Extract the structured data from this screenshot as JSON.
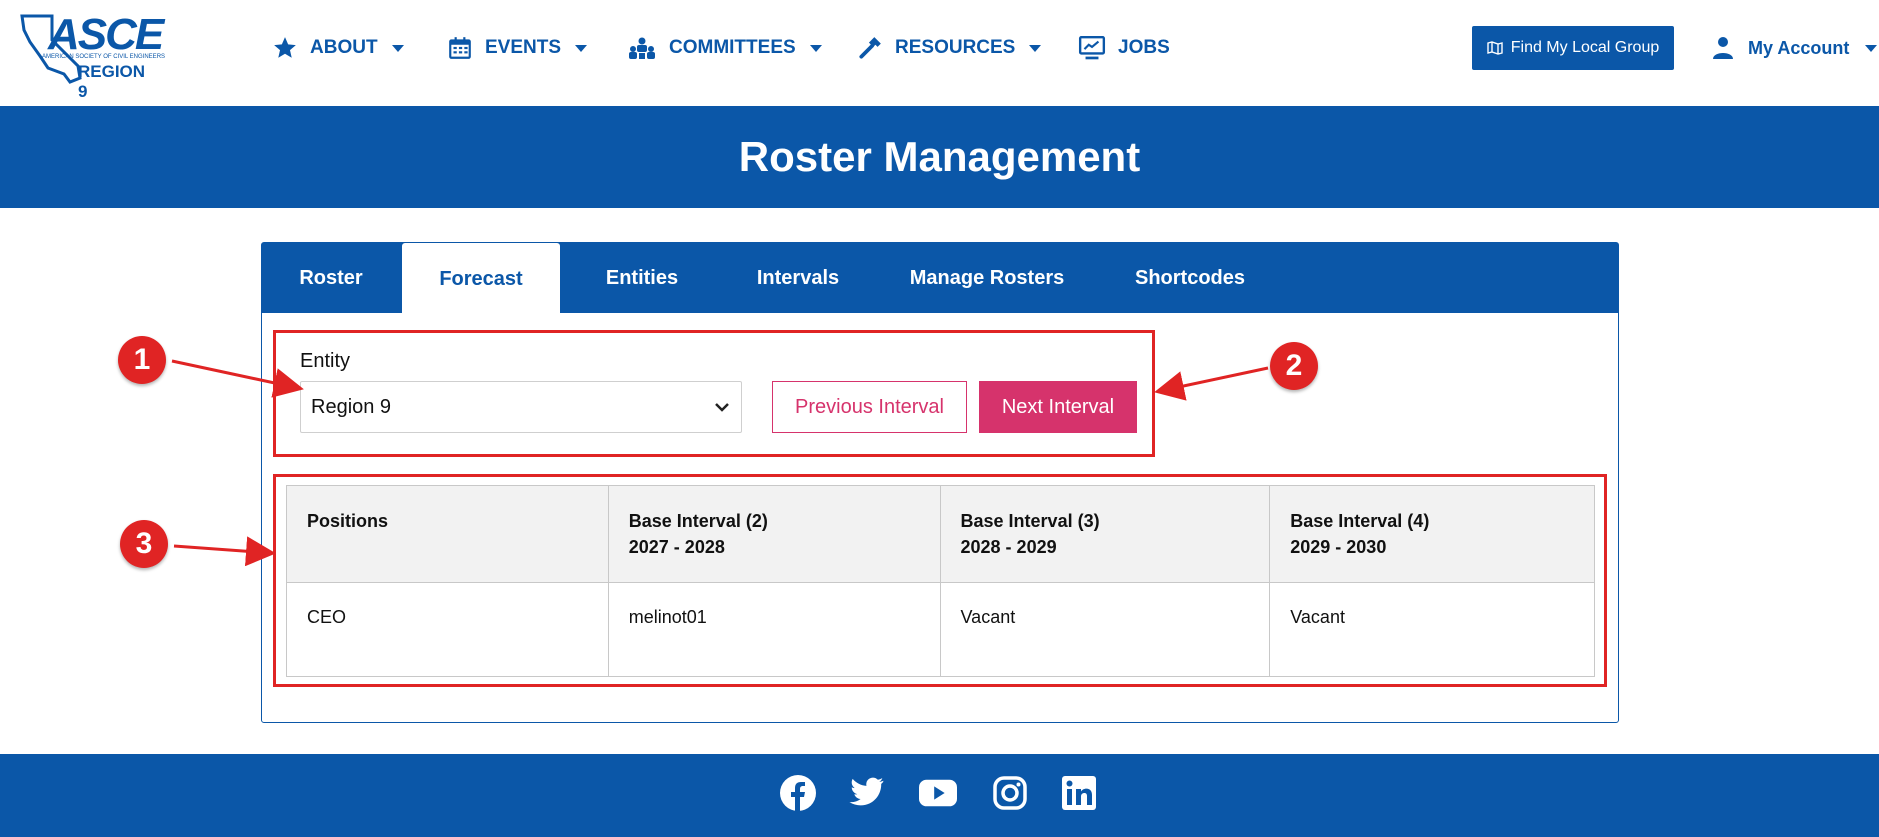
{
  "logo": {
    "name": "ASCE",
    "tagline": "AMERICAN SOCIETY OF CIVIL ENGINEERS",
    "region": "REGION 9"
  },
  "nav": {
    "items": [
      {
        "label": "ABOUT",
        "icon": "star-icon",
        "has_dropdown": true
      },
      {
        "label": "EVENTS",
        "icon": "calendar-icon",
        "has_dropdown": true
      },
      {
        "label": "COMMITTEES",
        "icon": "group-icon",
        "has_dropdown": true
      },
      {
        "label": "RESOURCES",
        "icon": "hammer-icon",
        "has_dropdown": true
      },
      {
        "label": "JOBS",
        "icon": "monitor-chart-icon",
        "has_dropdown": false
      }
    ],
    "find_group_label": "Find My Local Group",
    "account_label": "My Account"
  },
  "banner": {
    "title": "Roster Management"
  },
  "tabs": [
    {
      "label": "Roster",
      "active": false
    },
    {
      "label": "Forecast",
      "active": true
    },
    {
      "label": "Entities",
      "active": false
    },
    {
      "label": "Intervals",
      "active": false
    },
    {
      "label": "Manage Rosters",
      "active": false
    },
    {
      "label": "Shortcodes",
      "active": false
    }
  ],
  "controls": {
    "entity_label": "Entity",
    "entity_value": "Region 9",
    "previous_label": "Previous Interval",
    "next_label": "Next Interval"
  },
  "table": {
    "headers": [
      {
        "line1": "Positions",
        "line2": ""
      },
      {
        "line1": "Base Interval (2)",
        "line2": "2027 - 2028"
      },
      {
        "line1": "Base Interval (3)",
        "line2": "2028 - 2029"
      },
      {
        "line1": "Base Interval (4)",
        "line2": "2029 - 2030"
      }
    ],
    "rows": [
      [
        "CEO",
        "melinot01",
        "Vacant",
        "Vacant"
      ]
    ]
  },
  "annotations": [
    "1",
    "2",
    "3"
  ],
  "footer": {
    "social": [
      "facebook-icon",
      "twitter-icon",
      "youtube-icon",
      "instagram-icon",
      "linkedin-icon"
    ]
  },
  "colors": {
    "brand": "#0b57a8",
    "accent": "#d6336c",
    "annotation": "#e02424"
  }
}
